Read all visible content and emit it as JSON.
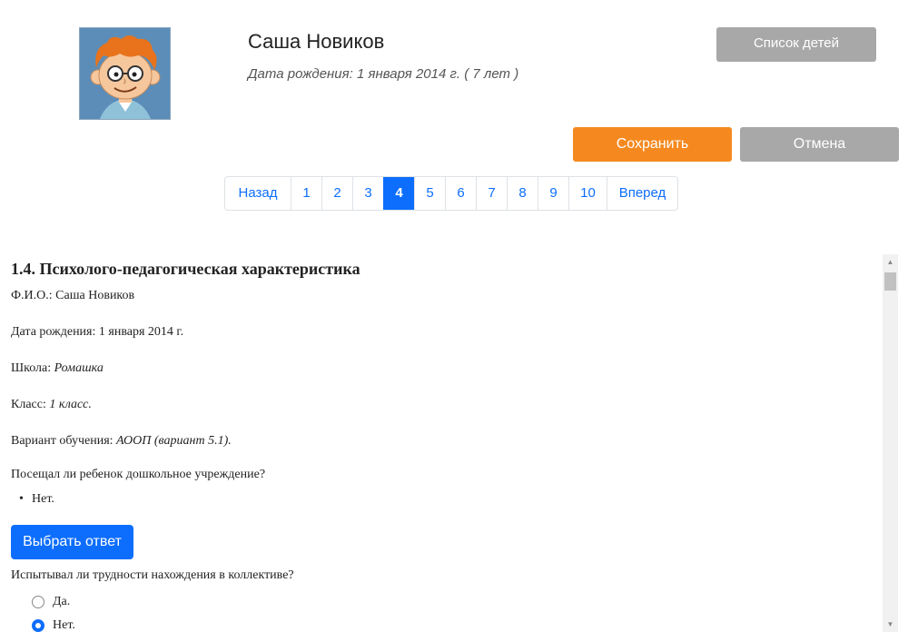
{
  "profile": {
    "name": "Саша Новиков",
    "birth": "Дата рождения: 1 января 2014 г. ( 7 лет )",
    "avatar_icon": "boy-with-glasses-avatar"
  },
  "buttons": {
    "children_list": "Список детей",
    "save": "Сохранить",
    "cancel": "Отмена",
    "choose_answer": "Выбрать ответ"
  },
  "colors": {
    "accent_orange": "#f5891f",
    "primary_blue": "#0d6efd",
    "muted_gray": "#a8a8a8"
  },
  "pagination": {
    "prev": "Назад",
    "next": "Вперед",
    "pages": [
      "1",
      "2",
      "3",
      "4",
      "5",
      "6",
      "7",
      "8",
      "9",
      "10"
    ],
    "active": "4"
  },
  "section": {
    "title": "1.4. Психолого-педагогическая характеристика",
    "fio_label": "Ф.И.О.:",
    "fio_value": "Саша Новиков",
    "birth_label": "Дата рождения:",
    "birth_value": "1 января 2014 г.",
    "school_label": "Школа:",
    "school_value": "Ромашка",
    "class_label": "Класс:",
    "class_value": "1 класс.",
    "variant_label": "Вариант обучения:",
    "variant_value": "АООП (вариант 5.1).",
    "q1": "Посещал ли ребенок дошкольное учреждение?",
    "q1_answer": "Нет.",
    "q2": "Испытывал ли трудности нахождения в коллективе?",
    "q2_options": [
      {
        "label": "Да.",
        "checked": false
      },
      {
        "label": "Нет.",
        "checked": true
      }
    ]
  },
  "scrollbar": {
    "up_icon": "scroll-up-arrow-icon",
    "down_icon": "scroll-down-arrow-icon"
  }
}
